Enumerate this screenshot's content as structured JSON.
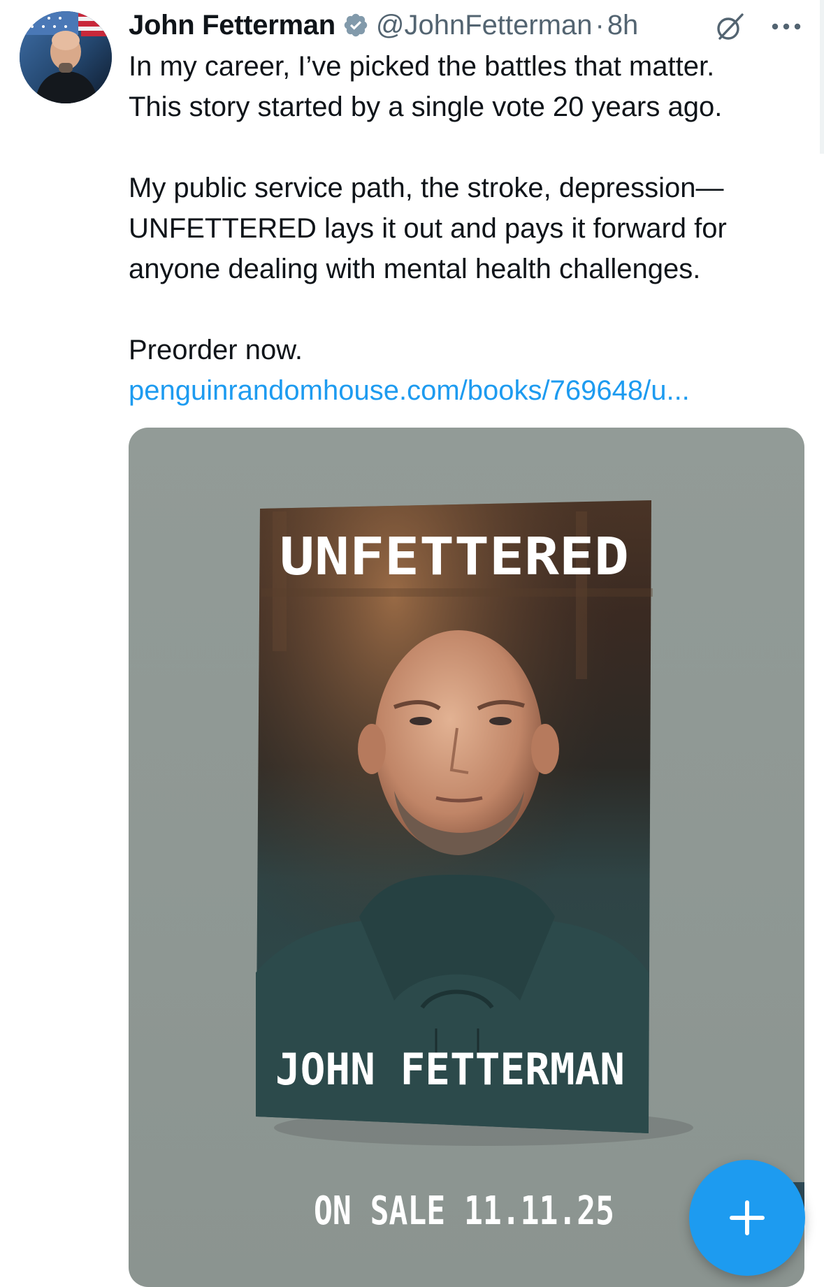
{
  "author": {
    "display_name": "John Fetterman",
    "handle": "@JohnFetterman",
    "separator": "·",
    "time_ago": "8h",
    "verified": true
  },
  "post": {
    "lines_1": [
      "In my career, I’ve picked the battles that matter.",
      "This story started by a single vote 20 years ago."
    ],
    "lines_2": [
      "My public service path, the stroke, depression—",
      "UNFETTERED lays it out and pays it forward for",
      "anyone dealing with mental health challenges."
    ],
    "lines_3": [
      "Preorder now."
    ],
    "link_text": "penguinrandomhouse.com/books/769648/u..."
  },
  "media": {
    "book_title": "UNFETTERED",
    "book_author": "JOHN FETTERMAN",
    "on_sale_text": "ON SALE 11.11.25"
  },
  "icons": {
    "verified": "verified-badge-icon",
    "grok": "grok-icon",
    "more": "more-options-icon",
    "compose": "compose-plus-icon"
  },
  "colors": {
    "text_primary": "#0f1419",
    "text_secondary": "#536471",
    "link": "#1d9bf0",
    "accent": "#1d9bf0",
    "media_background": "#8f9894"
  }
}
